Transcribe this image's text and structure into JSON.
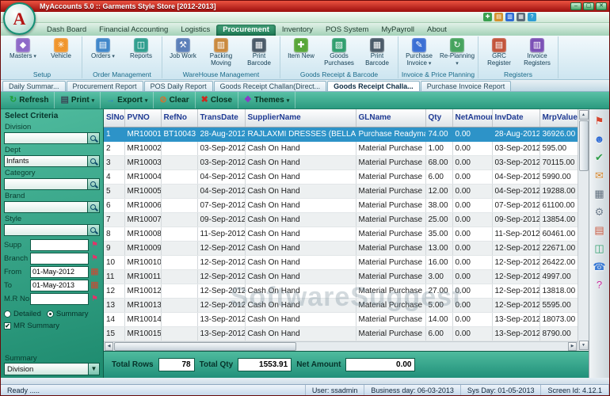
{
  "window": {
    "title": "MyAccounts 5.0 :: Garments Style Store [2012-2013]",
    "logo_letter": "A",
    "controls": {
      "minimize": "–",
      "maximize": "▢",
      "close": "✕"
    }
  },
  "quick_icons": [
    {
      "name": "quick-new-icon",
      "glyph": "✚",
      "color": "#3aa04e"
    },
    {
      "name": "quick-open-icon",
      "glyph": "▤",
      "color": "#d4912e"
    },
    {
      "name": "quick-save-icon",
      "glyph": "▥",
      "color": "#2e6bd4"
    },
    {
      "name": "quick-print-icon",
      "glyph": "▦",
      "color": "#5a6b7a"
    },
    {
      "name": "quick-help-icon",
      "glyph": "?",
      "color": "#2e9ed4"
    }
  ],
  "menu_tabs": {
    "items": [
      "Dash Board",
      "Financial Accounting",
      "Logistics",
      "Procurement",
      "Inventory",
      "POS System",
      "MyPayroll",
      "About"
    ],
    "active": "Procurement"
  },
  "ribbon": {
    "groups": [
      {
        "label": "Setup",
        "buttons": [
          {
            "label": "Masters",
            "icon": "masters-icon",
            "glyph": "◆",
            "color": "#8e6ac8",
            "dropdown": true
          },
          {
            "label": "Vehicle",
            "icon": "vehicle-icon",
            "glyph": "✳",
            "color": "#f0962e",
            "dropdown": false
          }
        ]
      },
      {
        "label": "Order Management",
        "buttons": [
          {
            "label": "Orders",
            "icon": "orders-icon",
            "glyph": "▤",
            "color": "#3f86c9",
            "dropdown": true
          },
          {
            "label": "Reports",
            "icon": "reports-icon",
            "glyph": "◫",
            "color": "#2f9e8e",
            "dropdown": false
          }
        ]
      },
      {
        "label": "WareHouse Management",
        "buttons": [
          {
            "label": "Job Work",
            "icon": "job-work-icon",
            "glyph": "⚒",
            "color": "#5b7fb9",
            "dropdown": false
          },
          {
            "label": "Packing Moving",
            "icon": "packing-moving-icon",
            "glyph": "▥",
            "color": "#c9893d",
            "dropdown": false
          },
          {
            "label": "Print Barcode",
            "icon": "print-barcode-icon",
            "glyph": "▦",
            "color": "#4a5a68",
            "dropdown": false
          }
        ]
      },
      {
        "label": "Goods Receipt & Barcode",
        "buttons": [
          {
            "label": "Item New",
            "icon": "item-new-icon",
            "glyph": "✚",
            "color": "#57a639",
            "dropdown": false
          },
          {
            "label": "Goods Purchases",
            "icon": "goods-purchases-icon",
            "glyph": "▧",
            "color": "#2f9e6e",
            "dropdown": false
          },
          {
            "label": "Print Barcode",
            "icon": "print-barcode2-icon",
            "glyph": "▦",
            "color": "#4a5a68",
            "dropdown": false
          }
        ]
      },
      {
        "label": "Invoice & Price Planning",
        "buttons": [
          {
            "label": "Purchase Invoice",
            "icon": "purchase-invoice-icon",
            "glyph": "✎",
            "color": "#3b6fd4",
            "dropdown": true
          },
          {
            "label": "Re-Planning",
            "icon": "re-planning-icon",
            "glyph": "↻",
            "color": "#46a35e",
            "dropdown": true
          }
        ]
      },
      {
        "label": "Registers",
        "buttons": [
          {
            "label": "GRC Register",
            "icon": "grc-register-icon",
            "glyph": "▤",
            "color": "#c2533a",
            "dropdown": false
          },
          {
            "label": "Invoice Registers",
            "icon": "invoice-registers-icon",
            "glyph": "▥",
            "color": "#7a4fb5",
            "dropdown": false
          }
        ]
      }
    ]
  },
  "doc_tabs": {
    "items": [
      "Daily Summar...",
      "Procurement Report",
      "POS Daily Report",
      "Goods Receipt Challan(Direct...",
      "Goods Receipt Challa...",
      "Purchase Invoice Report"
    ],
    "active_index": 4
  },
  "toolbar": {
    "buttons": [
      {
        "label": "Refresh",
        "icon": "refresh-icon",
        "glyph": "↻",
        "color": "#1f9e3a",
        "dropdown": false
      },
      {
        "label": "Print",
        "icon": "print-icon",
        "glyph": "▤",
        "color": "#3a4a58",
        "dropdown": true
      },
      {
        "label": "Export",
        "icon": "export-icon",
        "glyph": "→",
        "color": "#2e7dd4",
        "dropdown": true
      },
      {
        "label": "Clear",
        "icon": "clear-icon",
        "glyph": "⊘",
        "color": "#d4722e",
        "dropdown": false
      },
      {
        "label": "Close",
        "icon": "close-icon",
        "glyph": "✖",
        "color": "#cc2a1e",
        "dropdown": false
      },
      {
        "label": "Themes",
        "icon": "themes-icon",
        "glyph": "❖",
        "color": "#8a3ac9",
        "dropdown": true
      }
    ]
  },
  "sidebar": {
    "header": "Select Criteria",
    "lookups": [
      {
        "label": "Division",
        "value": ""
      },
      {
        "label": "Dept",
        "value": "Infants"
      },
      {
        "label": "Category",
        "value": ""
      },
      {
        "label": "Brand",
        "value": ""
      },
      {
        "label": "Style",
        "value": ""
      }
    ],
    "inline_fields": [
      {
        "label": "Supp",
        "value": "",
        "icon": "filter-icon"
      },
      {
        "label": "Branch",
        "value": "",
        "icon": "filter-icon"
      },
      {
        "label": "From",
        "value": "01-May-2012",
        "icon": "calendar-icon"
      },
      {
        "label": "To",
        "value": "01-May-2013",
        "icon": "calendar-icon"
      },
      {
        "label": "M.R No",
        "value": "",
        "icon": "filter-icon"
      }
    ],
    "radios": [
      {
        "label": "Detailed",
        "checked": false
      },
      {
        "label": "Summary",
        "checked": true
      }
    ],
    "checkboxes": [
      {
        "label": "MR Summary",
        "checked": true
      }
    ],
    "summary": {
      "label": "Summary",
      "value": "Division"
    }
  },
  "table": {
    "columns": [
      "SlNo",
      "PVNO",
      "RefNo",
      "TransDate",
      "SupplierName",
      "GLName",
      "Qty",
      "NetAmount",
      "InvDate",
      "MrpValue"
    ],
    "selected_index": 0,
    "rows": [
      [
        "1",
        "MR10001",
        "BT10043",
        "28-Aug-2012",
        "RAJLAXMI DRESSES (BELLARY)",
        "Purchase Readymade (op",
        "74.00",
        "0.00",
        "28-Aug-2012",
        "36926.00"
      ],
      [
        "2",
        "MR10002",
        "",
        "03-Sep-2012",
        "Cash On Hand",
        "Material Purchase",
        "1.00",
        "0.00",
        "03-Sep-2012",
        "595.00"
      ],
      [
        "3",
        "MR10003",
        "",
        "03-Sep-2012",
        "Cash On Hand",
        "Material Purchase",
        "68.00",
        "0.00",
        "03-Sep-2012",
        "70115.00"
      ],
      [
        "4",
        "MR10004",
        "",
        "04-Sep-2012",
        "Cash On Hand",
        "Material Purchase",
        "6.00",
        "0.00",
        "04-Sep-2012",
        "5990.00"
      ],
      [
        "5",
        "MR10005",
        "",
        "04-Sep-2012",
        "Cash On Hand",
        "Material Purchase",
        "12.00",
        "0.00",
        "04-Sep-2012",
        "19288.00"
      ],
      [
        "6",
        "MR10006",
        "",
        "07-Sep-2012",
        "Cash On Hand",
        "Material Purchase",
        "38.00",
        "0.00",
        "07-Sep-2012",
        "61100.00"
      ],
      [
        "7",
        "MR10007",
        "",
        "09-Sep-2012",
        "Cash On Hand",
        "Material Purchase",
        "25.00",
        "0.00",
        "09-Sep-2012",
        "13854.00"
      ],
      [
        "8",
        "MR10008",
        "",
        "11-Sep-2012",
        "Cash On Hand",
        "Material Purchase",
        "35.00",
        "0.00",
        "11-Sep-2012",
        "60461.00"
      ],
      [
        "9",
        "MR10009",
        "",
        "12-Sep-2012",
        "Cash On Hand",
        "Material Purchase",
        "13.00",
        "0.00",
        "12-Sep-2012",
        "22671.00"
      ],
      [
        "10",
        "MR10010",
        "",
        "12-Sep-2012",
        "Cash On Hand",
        "Material Purchase",
        "16.00",
        "0.00",
        "12-Sep-2012",
        "26422.00"
      ],
      [
        "11",
        "MR10011",
        "",
        "12-Sep-2012",
        "Cash On Hand",
        "Material Purchase",
        "3.00",
        "0.00",
        "12-Sep-2012",
        "4997.00"
      ],
      [
        "12",
        "MR10012",
        "",
        "12-Sep-2012",
        "Cash On Hand",
        "Material Purchase",
        "27.00",
        "0.00",
        "12-Sep-2012",
        "13818.00"
      ],
      [
        "13",
        "MR10013",
        "",
        "12-Sep-2012",
        "Cash On Hand",
        "Material Purchase",
        "5.00",
        "0.00",
        "12-Sep-2012",
        "5595.00"
      ],
      [
        "14",
        "MR10014",
        "",
        "13-Sep-2012",
        "Cash On Hand",
        "Material Purchase",
        "14.00",
        "0.00",
        "13-Sep-2012",
        "18073.00"
      ],
      [
        "15",
        "MR10015",
        "",
        "13-Sep-2012",
        "Cash On Hand",
        "Material Purchase",
        "6.00",
        "0.00",
        "13-Sep-2012",
        "8790.00"
      ]
    ]
  },
  "totals": {
    "rows_label": "Total Rows",
    "rows_value": "78",
    "qty_label": "Total Qty",
    "qty_value": "1553.91",
    "net_label": "Net Amount",
    "net_value": "0.00"
  },
  "watermark": "SoftwareSuggest",
  "shortcut_icons": [
    {
      "name": "pin-icon",
      "glyph": "⚑",
      "color": "#d6452e"
    },
    {
      "name": "contacts-icon",
      "glyph": "☻",
      "color": "#2e6bd4"
    },
    {
      "name": "approve-icon",
      "glyph": "✔",
      "color": "#2f9e4a"
    },
    {
      "name": "mail-icon",
      "glyph": "✉",
      "color": "#d4872e"
    },
    {
      "name": "calculator-icon",
      "glyph": "▦",
      "color": "#5a6b7a"
    },
    {
      "name": "settings-icon",
      "glyph": "⚙",
      "color": "#6b7a8a"
    },
    {
      "name": "scheduler-icon",
      "glyph": "▤",
      "color": "#c2533a"
    },
    {
      "name": "register-icon",
      "glyph": "◫",
      "color": "#2f9e6e"
    },
    {
      "name": "phone-icon",
      "glyph": "☎",
      "color": "#3a7ad4"
    },
    {
      "name": "help-icon",
      "glyph": "?",
      "color": "#c92ea0"
    }
  ],
  "status": {
    "ready": "Ready .....",
    "user": "User: ssadmin",
    "business_day": "Business day: 06-03-2013",
    "sys_day": "Sys Day: 01-05-2013",
    "screen_id": "Screen Id: 4.12.1"
  }
}
